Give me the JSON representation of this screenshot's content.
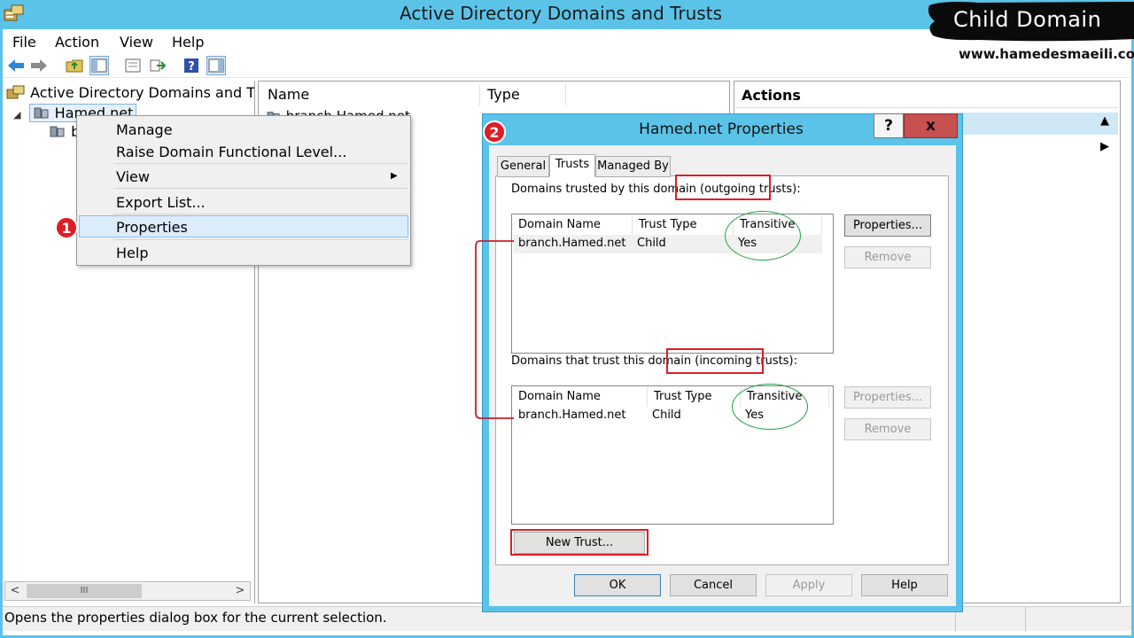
{
  "app": {
    "title": "Active Directory Domains and Trusts"
  },
  "menubar": {
    "items": [
      "File",
      "Action",
      "View",
      "Help"
    ]
  },
  "tree": {
    "root_label": "Active Directory Domains and T",
    "domain_label": "Hamed.net",
    "child_label": "b"
  },
  "list": {
    "columns": [
      "Name",
      "Type"
    ],
    "row": {
      "name": "branch.Hamed.net"
    }
  },
  "actions": {
    "title": "Actions"
  },
  "status": {
    "text": "Opens the properties dialog box for the current selection."
  },
  "context_menu": {
    "items": [
      "Manage",
      "Raise Domain Functional Level...",
      "View",
      "Export List...",
      "Properties",
      "Help"
    ]
  },
  "badges": {
    "step1": "1",
    "step2": "2"
  },
  "dialog": {
    "title": "Hamed.net Properties",
    "help_glyph": "?",
    "close_glyph": "x",
    "tabs": [
      "General",
      "Trusts",
      "Managed By"
    ],
    "outgoing_label_prefix": "Domains trusted by this domain ",
    "outgoing_label_highlight": "(outgoing trusts):",
    "incoming_label_prefix": "Domains that trust this domain ",
    "incoming_label_highlight": "(incoming trusts):",
    "columns": [
      "Domain Name",
      "Trust Type",
      "Transitive"
    ],
    "outgoing_rows": [
      {
        "domain": "branch.Hamed.net",
        "type": "Child",
        "transitive": "Yes"
      }
    ],
    "incoming_rows": [
      {
        "domain": "branch.Hamed.net",
        "type": "Child",
        "transitive": "Yes"
      }
    ],
    "buttons": {
      "properties": "Properties...",
      "remove": "Remove",
      "new_trust": "New Trust...",
      "ok": "OK",
      "cancel": "Cancel",
      "apply": "Apply",
      "help": "Help"
    }
  },
  "watermark": {
    "title": "Child Domain",
    "url": "www.hamedesmaeili.com"
  },
  "colors": {
    "titlebar": "#5bc3e8",
    "annotation_red": "#d81f26",
    "annotation_green": "#20a040",
    "close_button": "#c75050"
  }
}
